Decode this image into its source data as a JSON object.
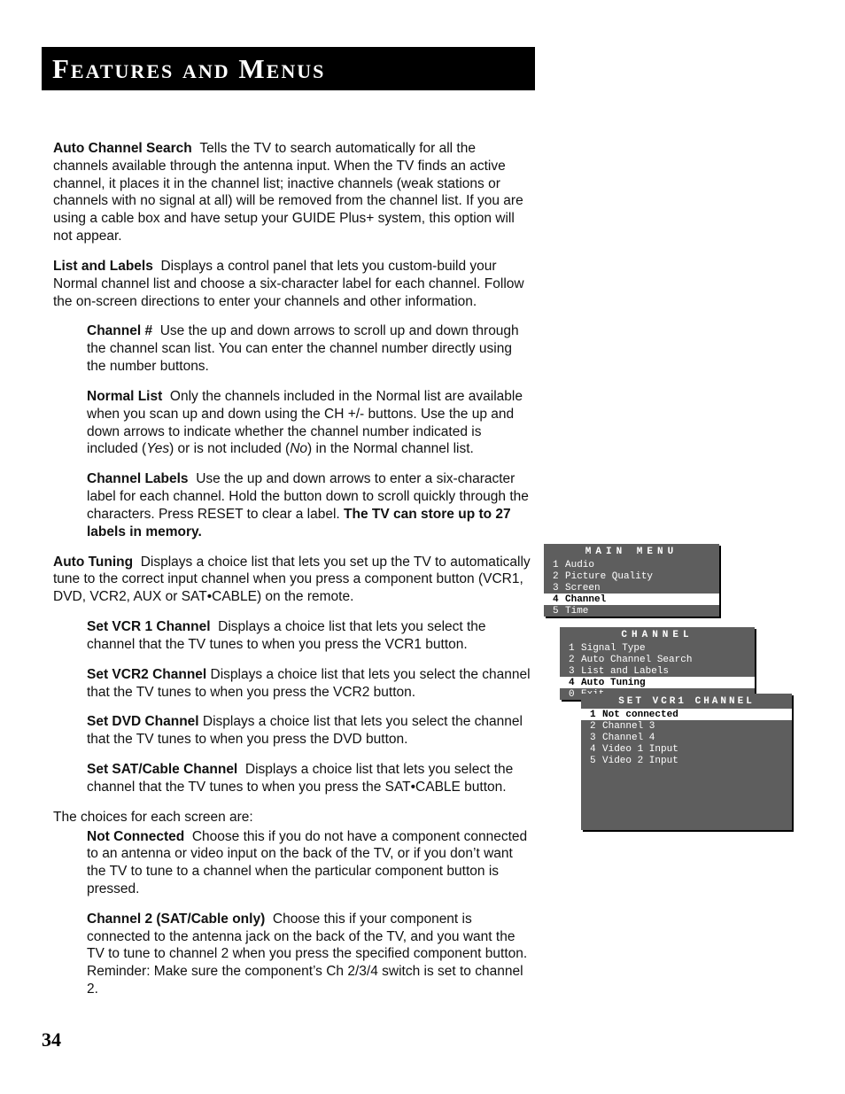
{
  "page": {
    "title": "Features and Menus",
    "number": "34"
  },
  "body": {
    "auto_channel_search": {
      "label": "Auto Channel Search",
      "text": "Tells the TV to search automatically for all the channels available through the antenna input. When the TV finds an active channel, it places it in the channel list; inactive channels (weak stations or channels with no signal at all) will be removed from the channel list. If you are using a cable box and have setup your GUIDE Plus+ system, this option will not appear."
    },
    "list_and_labels": {
      "label": "List and Labels",
      "text": "Displays a control panel that lets you custom-build your Normal channel list and choose a six-character label for each channel. Follow the on-screen directions to enter your channels and other information."
    },
    "channel_num": {
      "label": "Channel #",
      "text": "Use the up and down arrows to scroll up and down through the channel scan list. You can enter the channel number directly using the number buttons."
    },
    "normal_list": {
      "label": "Normal List",
      "text_a": "Only the channels included in the Normal list are available when you scan up and down using the CH +/- buttons. Use the up and down arrows to indicate whether the channel number indicated is included (",
      "yes": "Yes",
      "text_b": ") or is not included (",
      "no": "No",
      "text_c": ") in the Normal channel list."
    },
    "channel_labels": {
      "label": "Channel Labels",
      "text": "Use the up and down arrows to enter a six-character label for each channel. Hold the button down to scroll quickly through the characters. Press RESET to clear a label. ",
      "bold_tail": "The TV can store up to 27 labels in memory."
    },
    "auto_tuning": {
      "label": "Auto Tuning",
      "text": "Displays a choice list that lets you set up the TV to automatically tune to the correct input channel when you press a component button (VCR1, DVD, VCR2, AUX or SAT•CABLE) on the remote."
    },
    "set_vcr1": {
      "label": "Set VCR 1 Channel",
      "text": "Displays a choice list that lets you select the channel that the TV tunes to when you press the VCR1 button."
    },
    "set_vcr2": {
      "label": "Set VCR2 Channel",
      "text": "Displays a choice list that lets you select the channel that the TV tunes to when you press the VCR2 button."
    },
    "set_dvd": {
      "label": "Set DVD Channel",
      "text": "Displays a choice list that lets you select the channel that the TV tunes to when you press the DVD button."
    },
    "set_sat": {
      "label": "Set SAT/Cable Channel",
      "text": "Displays a choice list that lets you select the channel that the TV tunes to when you press the SAT•CABLE button."
    },
    "choices_intro": "The choices for each screen are:",
    "not_connected": {
      "label": "Not Connected",
      "text": "Choose this if you do not have a component connected to an antenna or video input on the back of the TV, or if you don’t want the TV to tune to a channel when the particular component button is pressed."
    },
    "channel2": {
      "label": "Channel 2 (SAT/Cable only)",
      "text": "Choose this if your component is connected to the antenna jack on the back of the TV, and you want the TV to tune to channel 2 when you press the specified component button. Reminder: Make sure the component’s Ch 2/3/4 switch is set to channel 2."
    }
  },
  "menus": {
    "main": {
      "title": "MAIN MENU",
      "items": [
        {
          "n": "1",
          "label": "Audio"
        },
        {
          "n": "2",
          "label": "Picture Quality"
        },
        {
          "n": "3",
          "label": "Screen"
        },
        {
          "n": "4",
          "label": "Channel",
          "selected": true
        },
        {
          "n": "5",
          "label": "Time"
        }
      ]
    },
    "channel": {
      "title": "CHANNEL",
      "items": [
        {
          "n": "1",
          "label": "Signal Type"
        },
        {
          "n": "2",
          "label": "Auto Channel Search"
        },
        {
          "n": "3",
          "label": "List and Labels"
        },
        {
          "n": "4",
          "label": "Auto Tuning",
          "selected": true
        },
        {
          "n": "0",
          "label": "Exit"
        }
      ]
    },
    "vcr1": {
      "title": "SET VCR1 CHANNEL",
      "items": [
        {
          "n": "1",
          "label": "Not connected",
          "selected": true
        },
        {
          "n": "2",
          "label": "Channel 3"
        },
        {
          "n": "3",
          "label": "Channel 4"
        },
        {
          "n": "4",
          "label": "Video 1 Input"
        },
        {
          "n": "5",
          "label": "Video 2 Input"
        }
      ]
    }
  }
}
